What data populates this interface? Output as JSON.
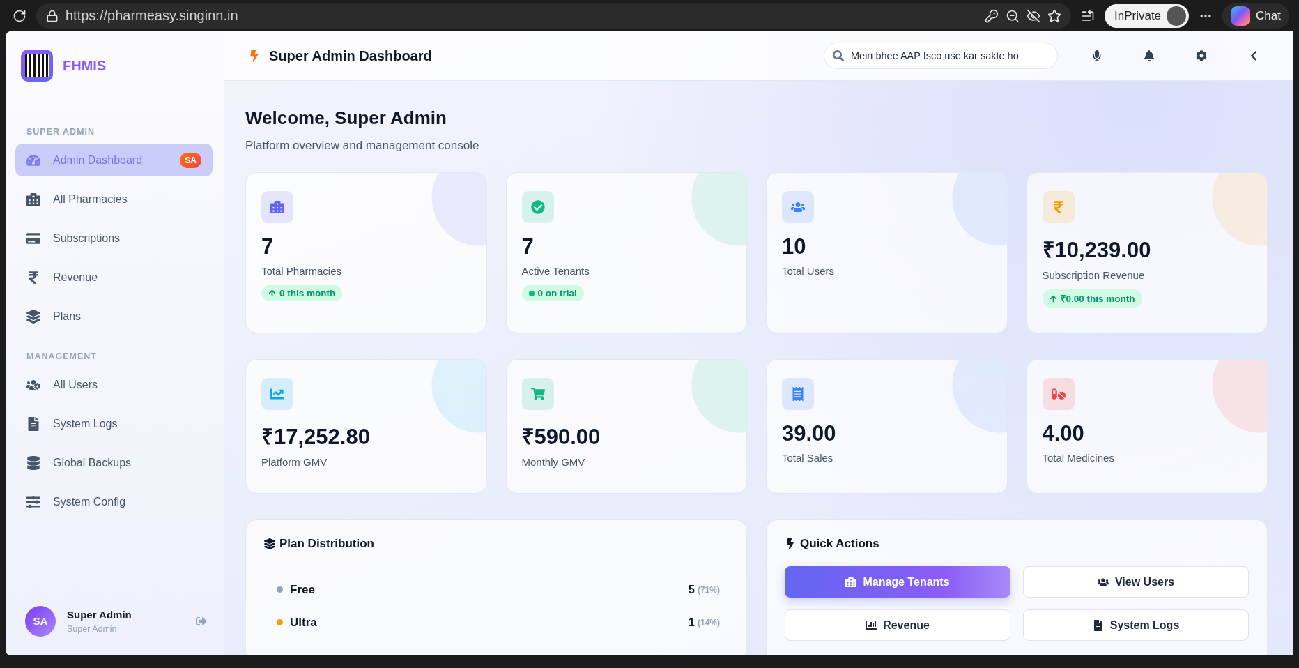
{
  "browser": {
    "url": "https://pharmeasy.singinn.in",
    "private_label": "InPrivate",
    "chat_label": "Chat"
  },
  "sidebar": {
    "brand": "FHMIS",
    "sections": [
      {
        "title": "SUPER ADMIN",
        "items": [
          {
            "label": "Admin Dashboard",
            "selected": true,
            "badge": "SA"
          },
          {
            "label": "All Pharmacies",
            "selected": false
          },
          {
            "label": "Subscriptions",
            "selected": false
          },
          {
            "label": "Revenue",
            "selected": false
          },
          {
            "label": "Plans",
            "selected": false
          }
        ]
      },
      {
        "title": "MANAGEMENT",
        "items": [
          {
            "label": "All Users",
            "selected": false
          },
          {
            "label": "System Logs",
            "selected": false
          },
          {
            "label": "Global Backups",
            "selected": false
          },
          {
            "label": "System Config",
            "selected": false
          }
        ]
      }
    ],
    "user": {
      "initials": "SA",
      "name": "Super Admin",
      "role": "Super Admin"
    }
  },
  "header": {
    "title": "Super Admin Dashboard",
    "search": {
      "value": "Mein bhee AAP Isco use kar sakte ho"
    }
  },
  "welcome": {
    "title": "Welcome, Super Admin",
    "subtitle": "Platform overview and management console"
  },
  "stats": [
    {
      "value": "7",
      "label": "Total Pharmacies",
      "color": "#6366f1",
      "note": {
        "kind": "up",
        "text": "0 this month"
      }
    },
    {
      "value": "7",
      "label": "Active Tenants",
      "color": "#10b981",
      "note": {
        "kind": "dot",
        "text": "0 on trial"
      }
    },
    {
      "value": "10",
      "label": "Total Users",
      "color": "#3b82f6"
    },
    {
      "value": "₹10,239.00",
      "label": "Subscription Revenue",
      "color": "#f59e0b",
      "note": {
        "kind": "up",
        "text": "₹0.00 this month"
      }
    },
    {
      "value": "₹17,252.80",
      "label": "Platform GMV",
      "color": "#0ea5e9"
    },
    {
      "value": "₹590.00",
      "label": "Monthly GMV",
      "color": "#10b981"
    },
    {
      "value": "39.00",
      "label": "Total Sales",
      "color": "#3b82f6"
    },
    {
      "value": "4.00",
      "label": "Total Medicines",
      "color": "#ef4444"
    }
  ],
  "plan_distribution": {
    "title": "Plan Distribution",
    "rows": [
      {
        "name": "Free",
        "color": "#94a3b8",
        "count": "5",
        "percent": "(71%)"
      },
      {
        "name": "Ultra",
        "color": "#f59e0b",
        "count": "1",
        "percent": "(14%)"
      }
    ]
  },
  "quick_actions": {
    "title": "Quick Actions",
    "buttons": [
      {
        "label": "Manage Tenants",
        "kind": "primary"
      },
      {
        "label": "View Users",
        "kind": "outline"
      },
      {
        "label": "Revenue",
        "kind": "outline"
      },
      {
        "label": "System Logs",
        "kind": "outline"
      }
    ]
  }
}
